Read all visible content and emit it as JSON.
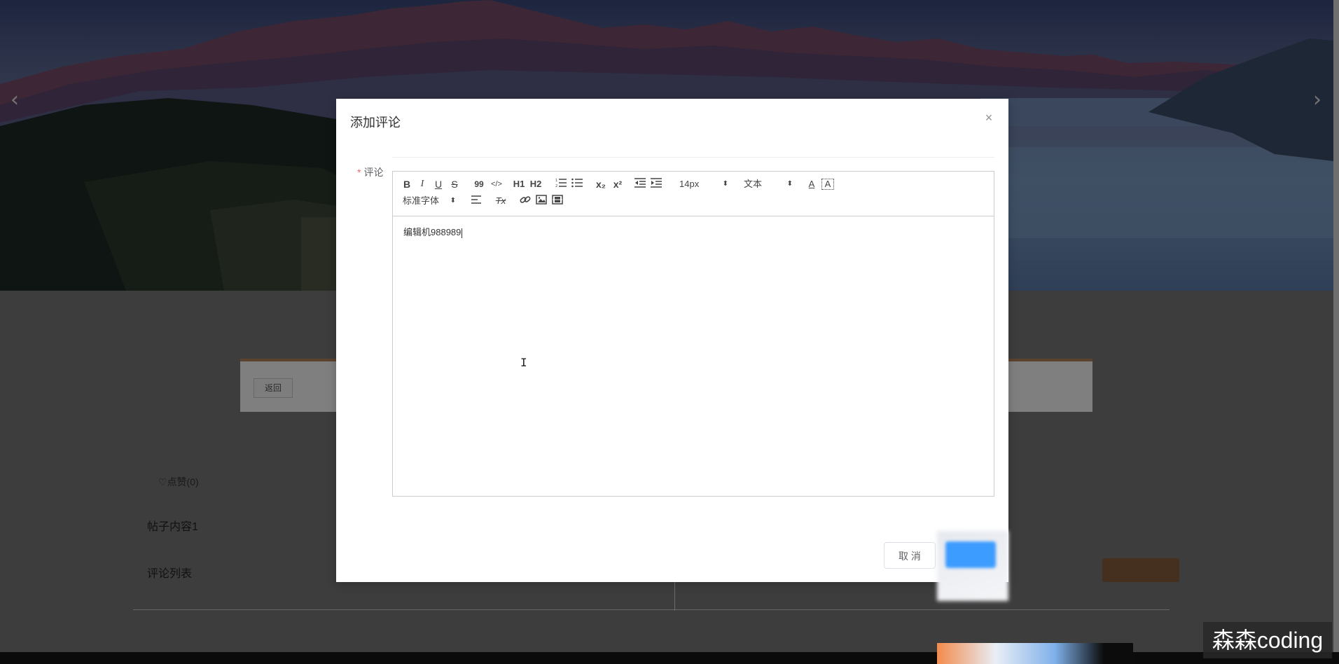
{
  "background": {
    "back_label": "返回",
    "like_label": "♡点赞(0)",
    "post_content": "帖子内容1",
    "comment_list_title": "评论列表"
  },
  "modal": {
    "title": "添加评论",
    "close_icon": "close-icon",
    "field_label": "评论",
    "required_mark": "*",
    "editor_content": "编辑机988989",
    "cancel_label": "取 消"
  },
  "toolbar": {
    "bold": "B",
    "italic": "I",
    "underline": "U",
    "strike": "S",
    "blockquote": "99",
    "code": "</>",
    "h1": "H1",
    "h2": "H2",
    "ordered_list": "ordered-list-icon",
    "bullet_list": "bullet-list-icon",
    "subscript": "x₂",
    "superscript": "x²",
    "outdent": "outdent-icon",
    "indent": "indent-icon",
    "size_value": "14px",
    "header_value": "文本",
    "font_color": "A",
    "background_color": "A",
    "font_value": "标准字体",
    "align": "align-icon",
    "clean": "Tx",
    "link": "link-icon",
    "image": "image-icon",
    "video": "video-icon"
  },
  "watermark": "森森coding",
  "colors": {
    "primary": "#409eff",
    "required": "#f56c6c",
    "card_accent": "#b7875d"
  }
}
